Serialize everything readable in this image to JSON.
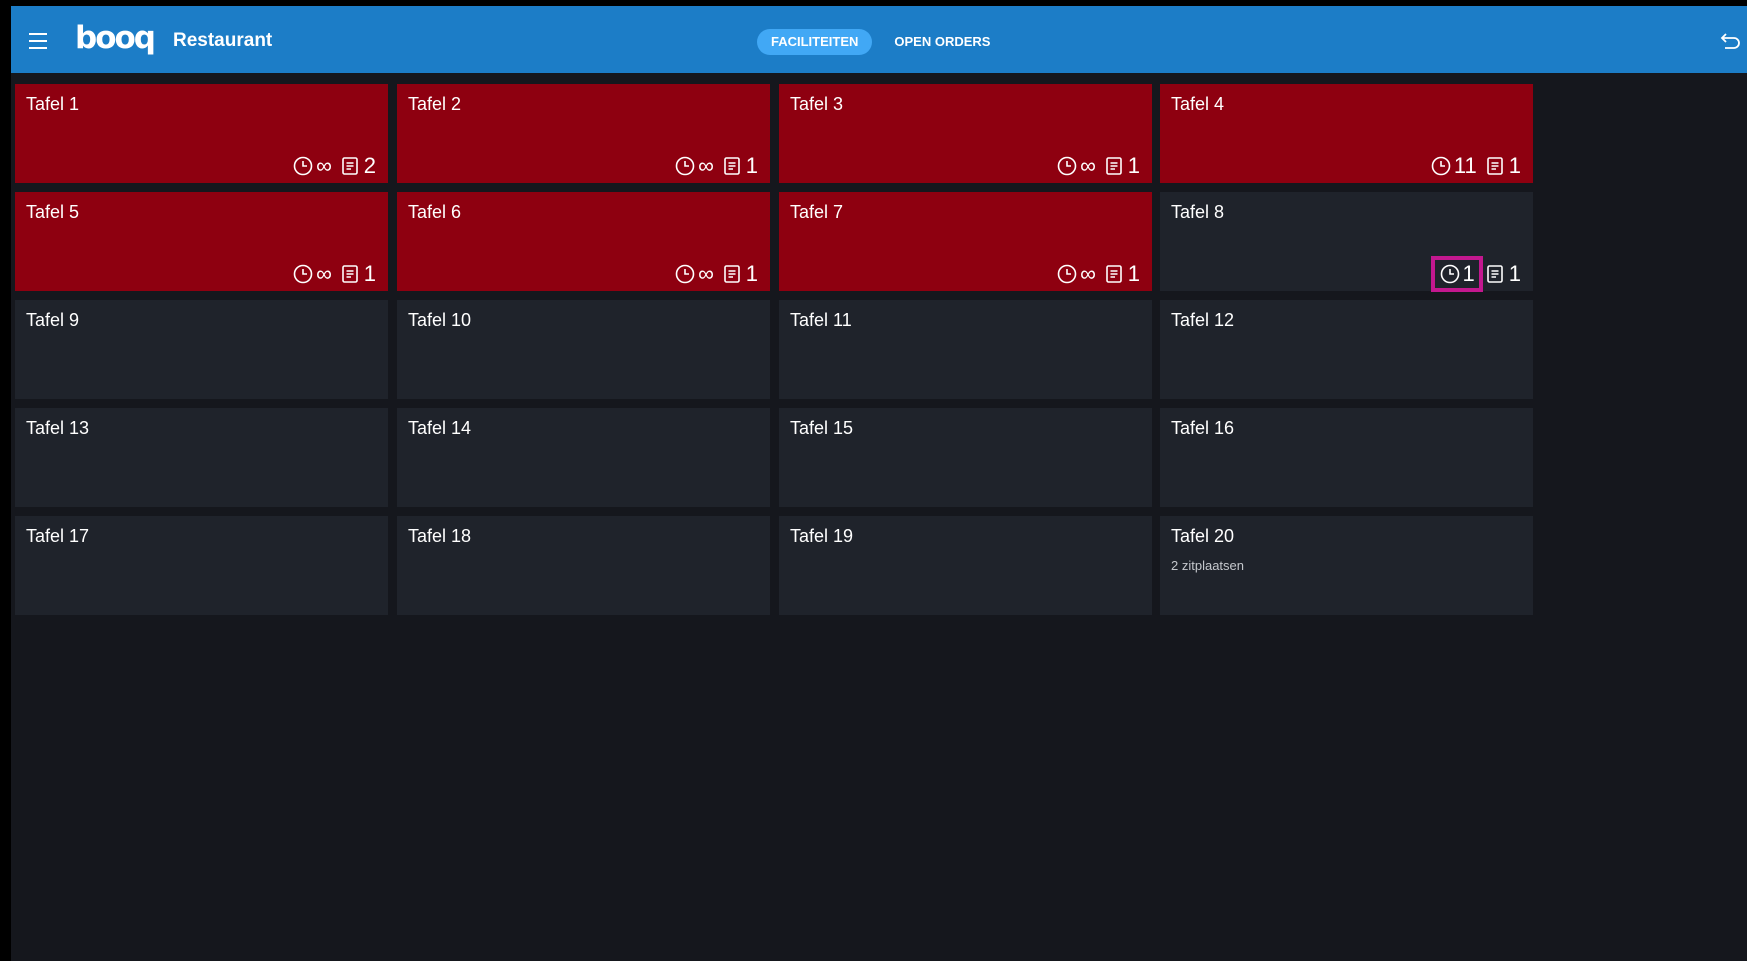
{
  "header": {
    "app_title": "Restaurant",
    "logo_text": "booq",
    "tabs": [
      {
        "label": "FACILITEITEN",
        "active": true
      },
      {
        "label": "OPEN ORDERS",
        "active": false
      }
    ]
  },
  "colors": {
    "header_bg": "#1c7dc7",
    "active_tab": "#41a8f5",
    "occupied_tile": "#8e0010",
    "free_tile": "#1f232b",
    "highlight": "#c3188f"
  },
  "tables": [
    {
      "name": "Tafel 1",
      "occupied": true,
      "time": "∞",
      "orders": "2"
    },
    {
      "name": "Tafel 2",
      "occupied": true,
      "time": "∞",
      "orders": "1"
    },
    {
      "name": "Tafel 3",
      "occupied": true,
      "time": "∞",
      "orders": "1"
    },
    {
      "name": "Tafel 4",
      "occupied": true,
      "time": "11",
      "orders": "1"
    },
    {
      "name": "Tafel 5",
      "occupied": true,
      "time": "∞",
      "orders": "1"
    },
    {
      "name": "Tafel 6",
      "occupied": true,
      "time": "∞",
      "orders": "1"
    },
    {
      "name": "Tafel 7",
      "occupied": true,
      "time": "∞",
      "orders": "1"
    },
    {
      "name": "Tafel 8",
      "occupied": false,
      "time": "1",
      "orders": "1",
      "highlighted": true
    },
    {
      "name": "Tafel 9",
      "occupied": false
    },
    {
      "name": "Tafel 10",
      "occupied": false
    },
    {
      "name": "Tafel 11",
      "occupied": false
    },
    {
      "name": "Tafel 12",
      "occupied": false
    },
    {
      "name": "Tafel 13",
      "occupied": false
    },
    {
      "name": "Tafel 14",
      "occupied": false
    },
    {
      "name": "Tafel 15",
      "occupied": false
    },
    {
      "name": "Tafel 16",
      "occupied": false
    },
    {
      "name": "Tafel 17",
      "occupied": false
    },
    {
      "name": "Tafel 18",
      "occupied": false
    },
    {
      "name": "Tafel 19",
      "occupied": false
    },
    {
      "name": "Tafel 20",
      "occupied": false,
      "subtitle": "2 zitplaatsen"
    }
  ]
}
